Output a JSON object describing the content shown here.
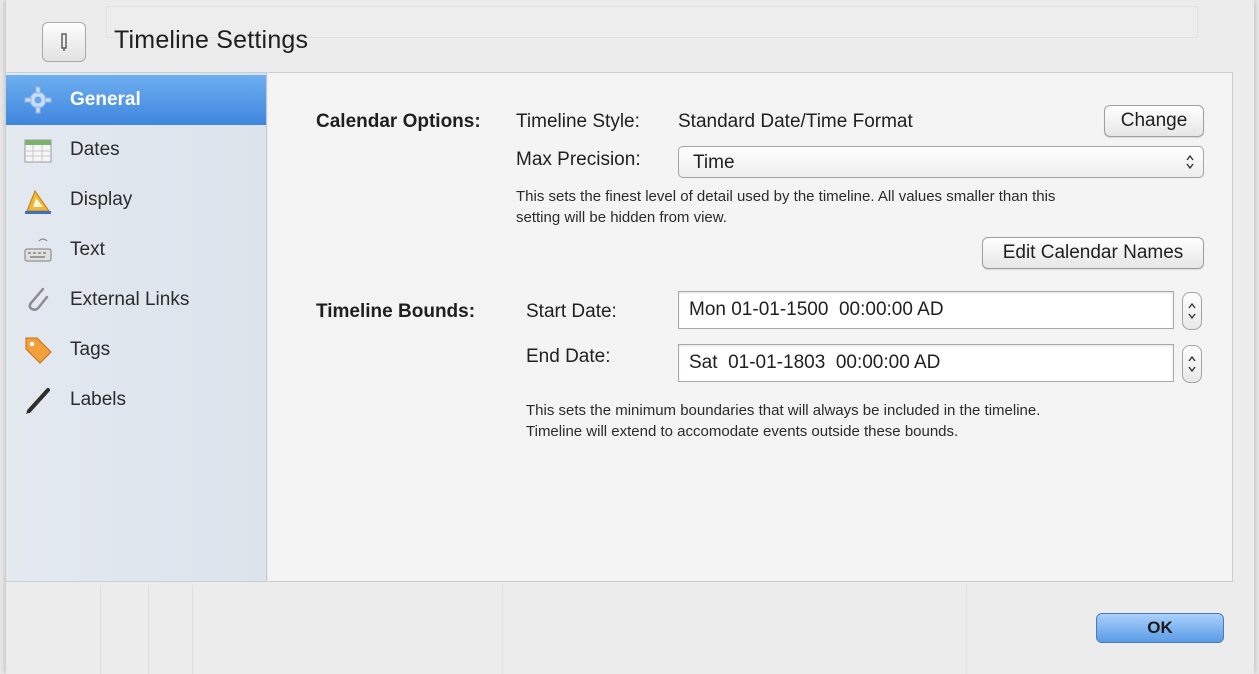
{
  "window": {
    "title": "Timeline Settings"
  },
  "sidebar": {
    "items": [
      {
        "label": "General",
        "icon": "gear-icon"
      },
      {
        "label": "Dates",
        "icon": "calendar-icon"
      },
      {
        "label": "Display",
        "icon": "triangle-ruler-icon"
      },
      {
        "label": "Text",
        "icon": "keyboard-icon"
      },
      {
        "label": "External Links",
        "icon": "paperclip-icon"
      },
      {
        "label": "Tags",
        "icon": "tag-icon"
      },
      {
        "label": "Labels",
        "icon": "pencil-icon"
      }
    ],
    "selected": "General"
  },
  "calendar": {
    "section_label": "Calendar Options:",
    "style_label": "Timeline Style:",
    "style_value": "Standard Date/Time Format",
    "change_button": "Change",
    "precision_label": "Max Precision:",
    "precision_value": "Time",
    "precision_hint_1": "This sets the finest level of detail used by the timeline. All values smaller than this",
    "precision_hint_2": "setting will be hidden from view.",
    "edit_names_button": "Edit Calendar Names"
  },
  "bounds": {
    "section_label": "Timeline Bounds:",
    "start_label": "Start Date:",
    "start_value": "Mon 01-01-1500  00:00:00 AD",
    "end_label": "End Date:",
    "end_value": "Sat  01-01-1803  00:00:00 AD",
    "hint_1": "This sets the minimum boundaries that will always be included in the timeline.",
    "hint_2": "Timeline will extend to accomodate events outside these bounds."
  },
  "footer": {
    "ok_button": "OK"
  },
  "colors": {
    "selection": "#4a90e2",
    "ok_button": "#6aa6ea"
  }
}
